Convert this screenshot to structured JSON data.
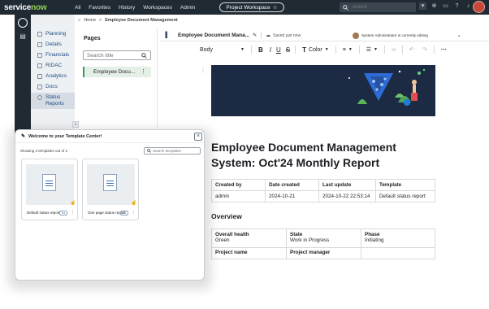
{
  "topnav": {
    "brand_service": "service",
    "brand_now": "now",
    "menu": [
      "All",
      "Favorites",
      "History",
      "Workspaces",
      "Admin"
    ],
    "workspace_pill": "Project Workspace",
    "search_placeholder": "Search"
  },
  "sidebar": {
    "items": [
      {
        "label": "Planning"
      },
      {
        "label": "Details"
      },
      {
        "label": "Financials"
      },
      {
        "label": "RIDAC"
      },
      {
        "label": "Analytics"
      },
      {
        "label": "Docs"
      },
      {
        "label": "Status Reports"
      }
    ]
  },
  "breadcrumb": {
    "home": "Home",
    "separator": ">",
    "current": "Employee Document Management"
  },
  "pages_panel": {
    "title": "Pages",
    "search_placeholder": "Search title",
    "page_item": "Employee Docu..."
  },
  "editor": {
    "doc_name": "Employee Document Mana...",
    "saved_status": "Saved just now",
    "editing_status": "System Administrator is currently editing",
    "toolbar": {
      "style": "Body",
      "bold": "B",
      "italic": "I",
      "underline": "U",
      "strike": "S",
      "color_label": "Color"
    }
  },
  "document": {
    "title": "Employee Document Management System: Oct'24 Monthly Report",
    "meta_table": {
      "headers": [
        "Created by",
        "Date created",
        "Last update",
        "Template"
      ],
      "row": [
        "admin",
        "2024-10-21",
        "2024-10-22 22:53:14",
        "Default status report"
      ]
    },
    "overview_heading": "Overview",
    "overview_table": {
      "row1_labels": [
        "Overall health",
        "State",
        "Phase"
      ],
      "row1_values": [
        "Green",
        "Work in Progress",
        "Initiating"
      ],
      "row2_labels": [
        "Project name",
        "Project manager"
      ]
    }
  },
  "modal": {
    "title": "Welcome to your Template Center!",
    "showing": "Showing 2 templates out of 2",
    "search_placeholder": "Search templates",
    "cards": [
      {
        "name": "Default status report",
        "more": "•••"
      },
      {
        "name": "One page status report",
        "more": "•••"
      }
    ]
  },
  "colors": {
    "nav_bg": "#1f2a33",
    "brand_green": "#8fd14f",
    "active_page": "#2e9e5b",
    "banner_bg": "#1c2b43"
  }
}
